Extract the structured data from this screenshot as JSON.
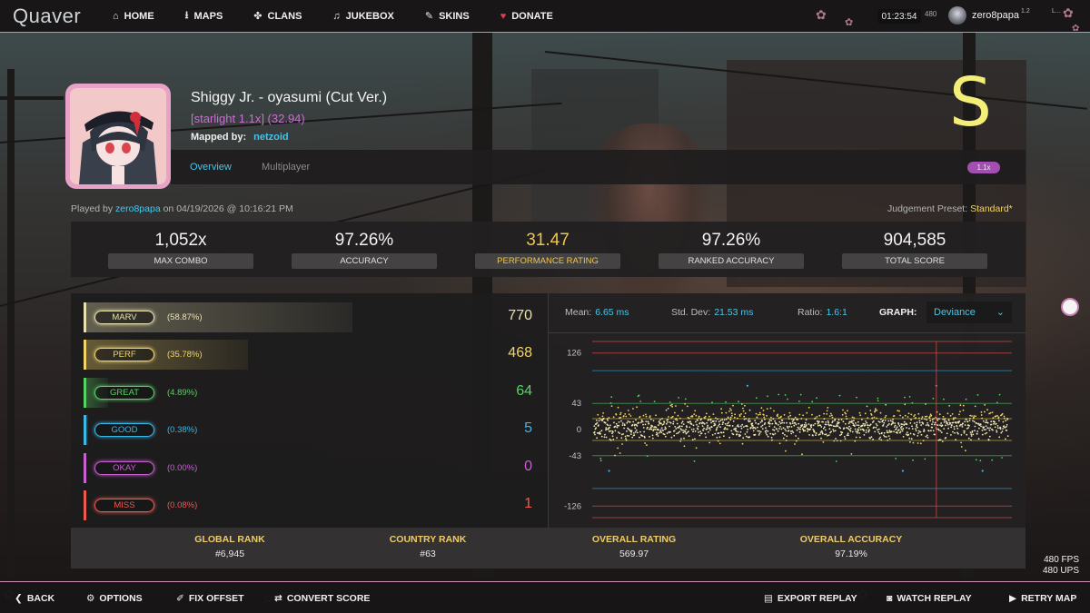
{
  "nav": {
    "logo": "Quaver",
    "items": [
      {
        "icon": "home-icon",
        "glyph": "⌂",
        "label": "HOME"
      },
      {
        "icon": "download-icon",
        "glyph": "⭳",
        "label": "MAPS"
      },
      {
        "icon": "paw-icon",
        "glyph": "✤",
        "label": "CLANS"
      },
      {
        "icon": "music-note-icon",
        "glyph": "♫",
        "label": "JUKEBOX"
      },
      {
        "icon": "brush-icon",
        "glyph": "✎",
        "label": "SKINS"
      },
      {
        "icon": "heart-icon",
        "glyph": "♥",
        "label": "DONATE"
      }
    ],
    "clock": "01:23:54",
    "small_num": "480",
    "username": "zero8papa",
    "lv": "1.2",
    "tiny_r": "L..."
  },
  "map": {
    "title": "Shiggy Jr. - oyasumi (Cut Ver.)",
    "difficulty": "[starlight 1.1x] (32.94)",
    "mapped_by_label": "Mapped by:",
    "mapper": "netzoid",
    "grade": "S",
    "mod_badge": "1.1x"
  },
  "tabs": {
    "overview": "Overview",
    "multiplayer": "Multiplayer"
  },
  "play_info": {
    "played_by_label": "Played by",
    "player": "zero8papa",
    "date_text": "on 04/19/2026 @ 10:16:21 PM",
    "judgement_label": "Judgement Preset:",
    "judgement_value": "Standard*"
  },
  "stats": [
    {
      "value": "1,052x",
      "label": "MAX COMBO"
    },
    {
      "value": "97.26%",
      "label": "ACCURACY"
    },
    {
      "value": "31.47",
      "label": "PERFORMANCE RATING"
    },
    {
      "value": "97.26%",
      "label": "RANKED ACCURACY"
    },
    {
      "value": "904,585",
      "label": "TOTAL SCORE"
    }
  ],
  "judgements": [
    {
      "name": "MARV",
      "pct": "(58.87%)",
      "count": "770",
      "color": "#e9e2b0",
      "fraction": 0.5887
    },
    {
      "name": "PERF",
      "pct": "(35.78%)",
      "count": "468",
      "color": "#f2d56a",
      "fraction": 0.3578
    },
    {
      "name": "GREAT",
      "pct": "(4.89%)",
      "count": "64",
      "color": "#57d364",
      "fraction": 0.0489
    },
    {
      "name": "GOOD",
      "pct": "(0.38%)",
      "count": "5",
      "color": "#3bb8e8",
      "fraction": 0.0038
    },
    {
      "name": "OKAY",
      "pct": "(0.00%)",
      "count": "0",
      "color": "#c85fd0",
      "fraction": 0.0
    },
    {
      "name": "MISS",
      "pct": "(0.08%)",
      "count": "1",
      "color": "#ec5a4d",
      "fraction": 0.0008
    }
  ],
  "graph": {
    "mean_label": "Mean:",
    "mean": "6.65 ms",
    "std_label": "Std. Dev:",
    "std": "21.53 ms",
    "ratio_label": "Ratio:",
    "ratio": "1.6:1",
    "graph_label": "GRAPH:",
    "mode": "Deviance",
    "y_ticks": [
      "126",
      "43",
      "0",
      "-43",
      "-126"
    ]
  },
  "chart_data": {
    "type": "scatter",
    "title": "",
    "xlabel": "",
    "ylabel": "",
    "ylim": [
      -145,
      145
    ],
    "y_ticks": [
      126,
      43,
      0,
      -43,
      -126
    ],
    "threshold_lines": [
      {
        "value": 145,
        "color": "#c9484b"
      },
      {
        "value": 126,
        "color": "#c9484b"
      },
      {
        "value": 97,
        "color": "#2f8ab7"
      },
      {
        "value": 43,
        "color": "#4aa557"
      },
      {
        "value": 18,
        "color": "#b7a33a"
      },
      {
        "value": -18,
        "color": "#b7a33a"
      },
      {
        "value": -43,
        "color": "#4aa557"
      },
      {
        "value": -97,
        "color": "#2f8ab7"
      },
      {
        "value": -126,
        "color": "#c9484b"
      },
      {
        "value": -145,
        "color": "#c9484b"
      }
    ],
    "miss_marker_x": 0.82,
    "point_count": 1308,
    "note_counts": {
      "marv": 770,
      "perf": 468,
      "great": 64,
      "good": 5,
      "miss": 1
    }
  },
  "ranks": [
    {
      "title": "GLOBAL RANK",
      "value": "#6,945"
    },
    {
      "title": "COUNTRY RANK",
      "value": "#63"
    },
    {
      "title": "OVERALL RATING",
      "value": "569.97"
    },
    {
      "title": "OVERALL ACCURACY",
      "value": "97.19%"
    }
  ],
  "fps": {
    "fps": "480 FPS",
    "ups": "480 UPS"
  },
  "bottom": {
    "back": "BACK",
    "options": "OPTIONS",
    "fix_offset": "FIX OFFSET",
    "convert_score": "CONVERT SCORE",
    "export_replay": "EXPORT REPLAY",
    "watch_replay": "WATCH REPLAY",
    "retry_map": "RETRY MAP"
  }
}
